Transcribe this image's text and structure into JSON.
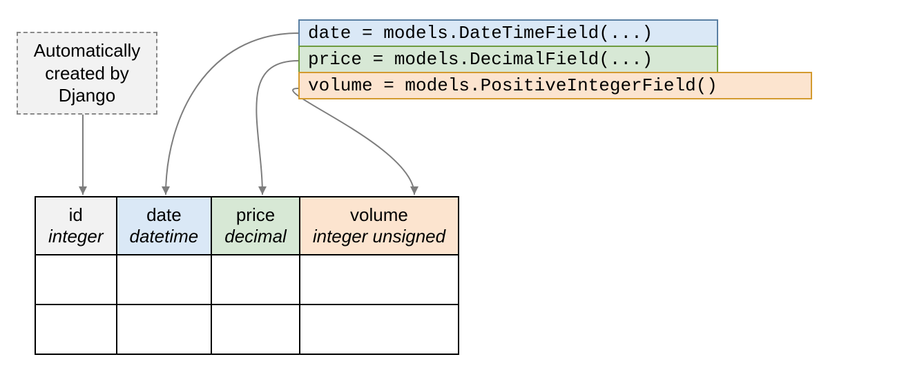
{
  "callout": {
    "text": "Automatically created by Django"
  },
  "code": {
    "date": "date = models.DateTimeField(...)",
    "price": "price = models.DecimalField(...)",
    "volume": "volume = models.PositiveIntegerField()"
  },
  "table": {
    "columns": [
      {
        "name": "id",
        "type": "integer",
        "class": "th-id"
      },
      {
        "name": "date",
        "type": "datetime",
        "class": "th-date"
      },
      {
        "name": "price",
        "type": "decimal",
        "class": "th-price"
      },
      {
        "name": "volume",
        "type": "integer unsigned",
        "class": "th-volume"
      }
    ],
    "emptyRows": 2
  },
  "colors": {
    "date_bg": "#dae8f6",
    "price_bg": "#d7e8d5",
    "volume_bg": "#fce4cf",
    "id_bg": "#f2f2f2"
  }
}
